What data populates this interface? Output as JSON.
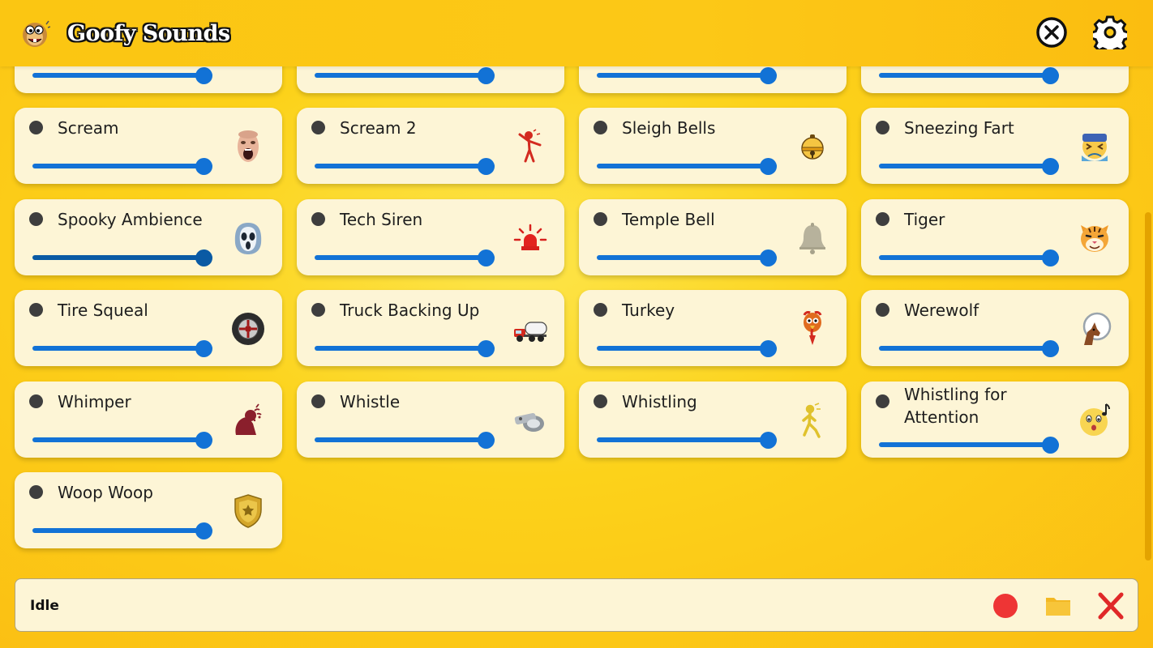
{
  "app": {
    "title": "Goofy Sounds"
  },
  "header": {
    "close_icon": "circle-x-icon",
    "settings_icon": "gear-icon"
  },
  "colors": {
    "accent": "#1272d6",
    "card_bg": "#fdf5d6",
    "header_bg": "#fbc612",
    "record": "#ee3535",
    "folder": "#f3b823",
    "stop": "#e02828"
  },
  "top_row_partial": [
    {
      "icon": "partial-icon",
      "volume": 1.0
    },
    {
      "icon": "partial-icon",
      "volume": 1.0
    },
    {
      "icon": "partial-icon",
      "volume": 1.0
    },
    {
      "icon": "partial-icon",
      "volume": 1.0
    }
  ],
  "sounds": [
    {
      "name": "Scream",
      "icon": "screaming-face-icon",
      "volume": 1.0
    },
    {
      "name": "Scream 2",
      "icon": "screaming-person-icon",
      "volume": 1.0
    },
    {
      "name": "Sleigh Bells",
      "icon": "sleigh-bell-icon",
      "volume": 1.0
    },
    {
      "name": "Sneezing Fart",
      "icon": "sneezing-face-icon",
      "volume": 1.0
    },
    {
      "name": "Spooky Ambience",
      "icon": "ghost-mask-icon",
      "volume": 1.0
    },
    {
      "name": "Tech Siren",
      "icon": "siren-light-icon",
      "volume": 1.0
    },
    {
      "name": "Temple Bell",
      "icon": "bell-icon",
      "volume": 1.0
    },
    {
      "name": "Tiger",
      "icon": "tiger-face-icon",
      "volume": 1.0
    },
    {
      "name": "Tire Squeal",
      "icon": "tire-icon",
      "volume": 1.0
    },
    {
      "name": "Truck Backing Up",
      "icon": "truck-icon",
      "volume": 1.0
    },
    {
      "name": "Turkey",
      "icon": "turkey-icon",
      "volume": 1.0
    },
    {
      "name": "Werewolf",
      "icon": "howling-wolf-icon",
      "volume": 1.0
    },
    {
      "name": "Whimper",
      "icon": "crying-person-icon",
      "volume": 1.0
    },
    {
      "name": "Whistle",
      "icon": "whistle-icon",
      "volume": 1.0
    },
    {
      "name": "Whistling",
      "icon": "whistling-person-icon",
      "volume": 1.0
    },
    {
      "name": "Whistling for Attention",
      "icon": "whistling-face-icon",
      "volume": 1.0
    },
    {
      "name": "Woop Woop",
      "icon": "police-badge-icon",
      "volume": 1.0
    }
  ],
  "status": {
    "text": "Idle",
    "record_icon": "record-icon",
    "folder_icon": "folder-icon",
    "stop_icon": "stop-x-icon"
  }
}
